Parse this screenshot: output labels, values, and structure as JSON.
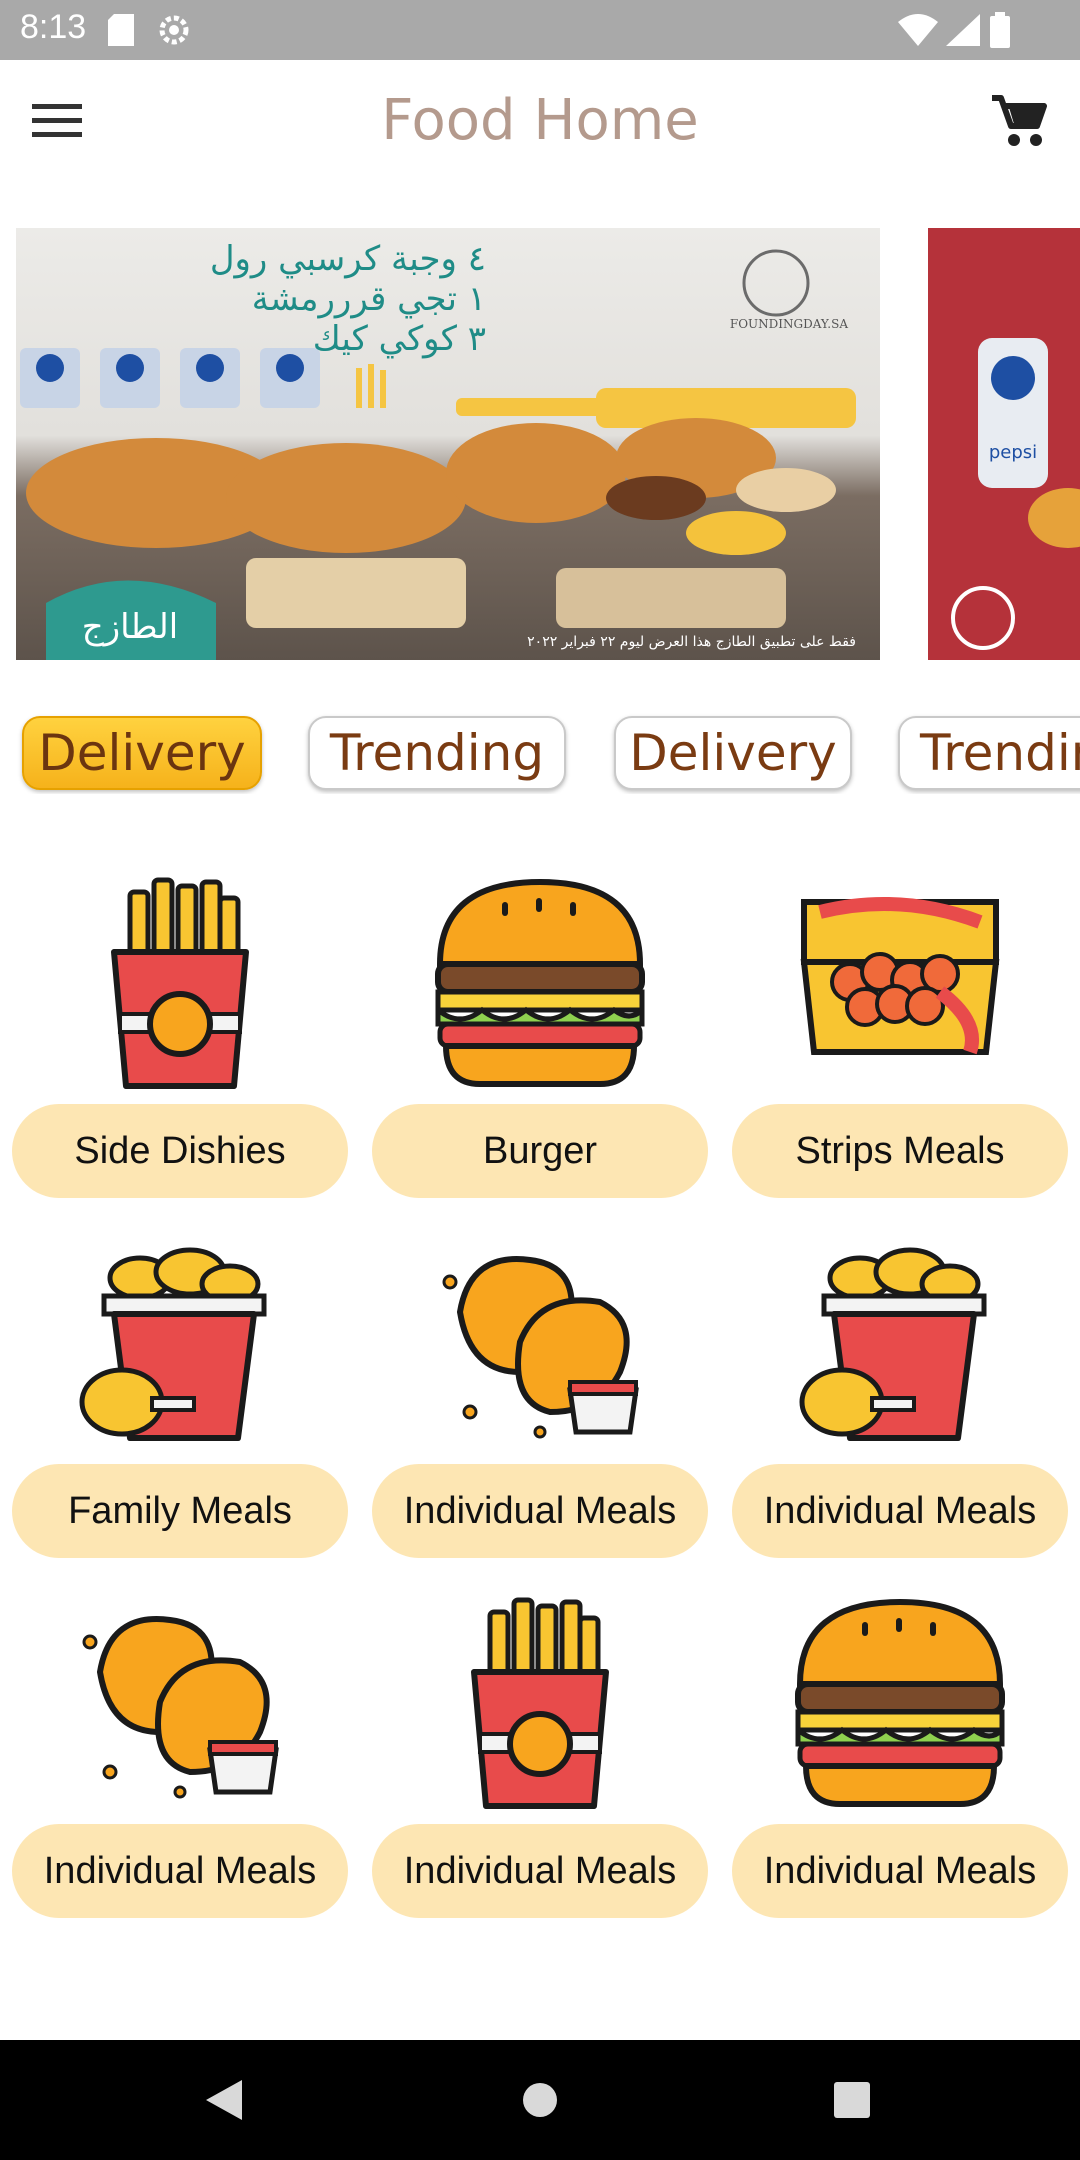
{
  "status_bar": {
    "time": "8:13"
  },
  "app_bar": {
    "title": "Food Home"
  },
  "banners": [
    {
      "arabic_lines": [
        "٤ وجبة كرسبي رول",
        "١ تجي قرررمشة",
        "٣ كوكي كيك"
      ],
      "brand": "الطازج",
      "logo_text": "FOUNDINGDAY.SA",
      "footer_text": "فقط على تطبيق الطازج هذا العرض ليوم ٢٢ فبراير ٢٠٢٢"
    },
    {
      "brand_text": "pepsi"
    }
  ],
  "chips": [
    {
      "label": "Delivery",
      "active": true
    },
    {
      "label": "Trending",
      "active": false
    },
    {
      "label": "Delivery",
      "active": false
    },
    {
      "label": "Trending",
      "active": false
    }
  ],
  "categories": [
    {
      "label": "Side Dishies",
      "icon": "fries-icon"
    },
    {
      "label": "Burger",
      "icon": "burger-icon"
    },
    {
      "label": "Strips Meals",
      "icon": "strips-box-icon"
    },
    {
      "label": "Family Meals",
      "icon": "chicken-bucket-icon"
    },
    {
      "label": "Individual Meals",
      "icon": "fried-chicken-icon"
    },
    {
      "label": "Individual Meals",
      "icon": "chicken-bucket-icon"
    },
    {
      "label": "Individual Meals",
      "icon": "fried-chicken-icon"
    },
    {
      "label": "Individual Meals",
      "icon": "fries-icon"
    },
    {
      "label": "Individual Meals",
      "icon": "burger-icon"
    }
  ],
  "colors": {
    "accent": "#f6b21b",
    "title": "#b49a8d",
    "chip_text": "#7a3b12",
    "label_bg": "#fde6b3"
  }
}
